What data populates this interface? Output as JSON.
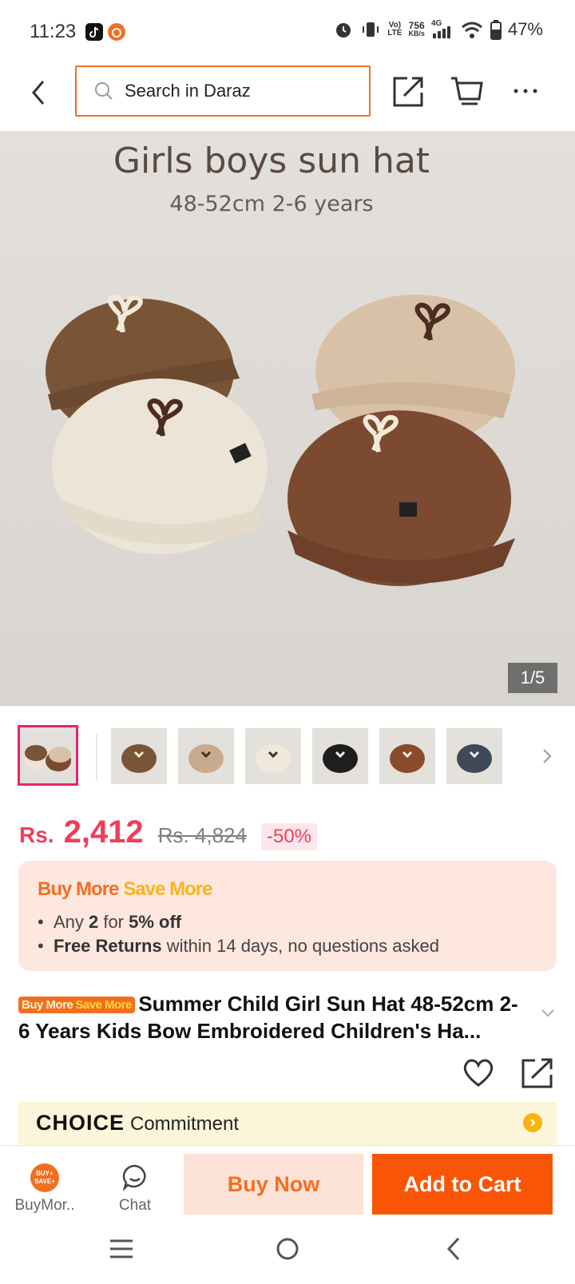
{
  "status_bar": {
    "time": "11:23",
    "volte_top": "Vo)",
    "volte_bottom": "LTE",
    "speed_value": "756",
    "speed_unit": "KB/s",
    "network": "4G",
    "battery": "47%",
    "icons": [
      "tiktok-icon",
      "app-notification-icon",
      "alarm-icon",
      "vibrate-icon",
      "signal-icon",
      "wifi-icon",
      "battery-icon"
    ]
  },
  "search": {
    "placeholder": "Search in Daraz"
  },
  "hero": {
    "title": "Girls boys sun hat",
    "subtitle": "48-52cm 2-6 years",
    "counter": "1/5"
  },
  "thumbnails": [
    {
      "color": "#7a5437",
      "selected": true
    },
    {
      "color": "#7a5437"
    },
    {
      "color": "#c8ab8e"
    },
    {
      "color": "#e8e0d4"
    },
    {
      "color": "#1e1e1e"
    },
    {
      "color": "#8a4a2c"
    },
    {
      "color": "#3e4a58"
    }
  ],
  "price": {
    "currency": "Rs.",
    "current": "2,412",
    "original": "Rs. 4,824",
    "discount": "-50%"
  },
  "promo": {
    "head_a": "Buy More",
    "head_b": "Save More",
    "line1_prefix": "Any ",
    "line1_count": "2",
    "line1_mid": " for ",
    "line1_off": "5% off",
    "line2_bold": "Free Returns",
    "line2_rest": " within 14 days, no questions asked"
  },
  "product": {
    "badge_a": "Buy More",
    "badge_b": "Save More",
    "title": "Summer Child Girl Sun Hat 48-52cm 2-6 Years Kids Bow Embroidered Children's Ha..."
  },
  "choice": {
    "logo": "CHOICE",
    "label": "Commitment"
  },
  "bottom_bar": {
    "buymore_badge_top": "BUY+",
    "buymore_badge_bottom": "SAVE+",
    "buymore_label": "BuyMor..",
    "chat_label": "Chat",
    "buy_now": "Buy Now",
    "add_to_cart": "Add to Cart"
  },
  "colors": {
    "accent": "#f85606",
    "price": "#f23c5a",
    "promo_bg": "#fde7df",
    "choice_bg": "#fdf5d9"
  }
}
